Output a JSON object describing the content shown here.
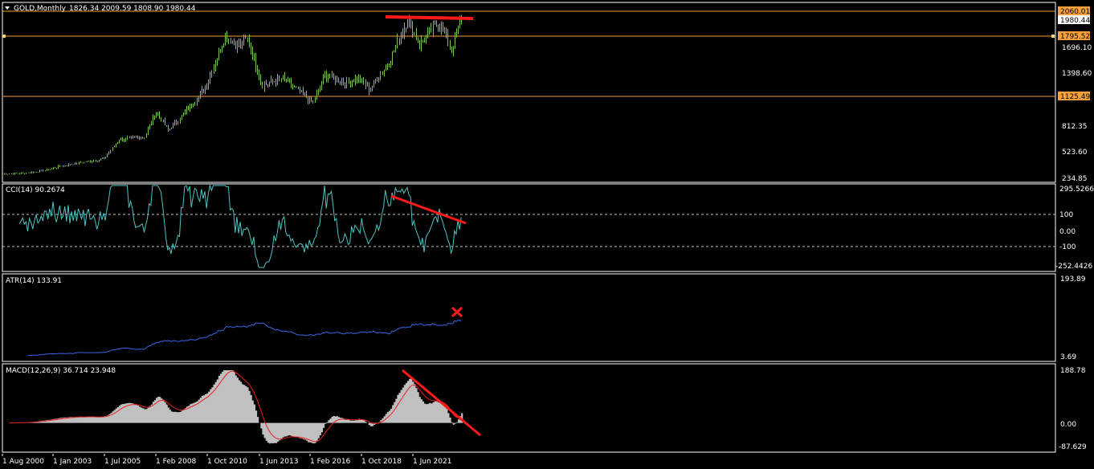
{
  "colors": {
    "background": "#000000",
    "frame": "#ffffff",
    "candles": "#7cc354",
    "level_line": "#f7a13a",
    "cci_line": "#4fc3c3",
    "atr_line": "#3d63e8",
    "macd_histogram": "#c0c0c0",
    "macd_signal": "#e81f1f",
    "drawing": "#ff1a1a",
    "dotted_level": "#c0c0c0"
  },
  "main_panel": {
    "header_symbol": "GOLD,Monthly",
    "header_values": "1826.34 2009.59 1808.90 1980.44",
    "price_axis": [
      "1696.10",
      "1398.60",
      "812.35",
      "523.60",
      "234.85"
    ],
    "price_tags": [
      {
        "text": "2060.01",
        "style": "orange"
      },
      {
        "text": "1980.44",
        "style": "white"
      },
      {
        "text": "1795.52",
        "style": "orange"
      },
      {
        "text": "1125.49",
        "style": "orange"
      }
    ]
  },
  "cci_panel": {
    "header": "CCI(14) 90.2674",
    "axis": [
      "295.5266",
      "100",
      "0.00",
      "-100",
      "-252.4426"
    ]
  },
  "atr_panel": {
    "header": "ATR(14) 133.91",
    "axis": [
      "193.89",
      "3.69"
    ],
    "marker_icon": "x-mark"
  },
  "macd_panel": {
    "header": "MACD(12,26,9) 36.714 23.948",
    "axis": [
      "188.78",
      "0.00",
      "-87.629"
    ]
  },
  "time_axis": [
    "1 Aug 2000",
    "1 Jan 2003",
    "1 Jul 2005",
    "1 Feb 2008",
    "1 Oct 2010",
    "1 Jun 2013",
    "1 Feb 2016",
    "1 Oct 2018",
    "1 Jun 2021"
  ],
  "chart_data": {
    "type": "candlestick",
    "symbol": "GOLD",
    "timeframe": "Monthly",
    "price_range": [
      234.85,
      2060.01
    ],
    "horizontal_levels": [
      2060.01,
      1795.52,
      1125.49
    ],
    "price_path": [
      [
        "2000-08",
        275
      ],
      [
        "2001-08",
        280
      ],
      [
        "2002-08",
        310
      ],
      [
        "2003-08",
        365
      ],
      [
        "2004-08",
        400
      ],
      [
        "2005-08",
        440
      ],
      [
        "2006-05",
        650
      ],
      [
        "2007-08",
        680
      ],
      [
        "2008-03",
        960
      ],
      [
        "2008-10",
        750
      ],
      [
        "2009-08",
        950
      ],
      [
        "2010-08",
        1220
      ],
      [
        "2011-08",
        1800
      ],
      [
        "2012-03",
        1680
      ],
      [
        "2012-09",
        1750
      ],
      [
        "2013-06",
        1250
      ],
      [
        "2014-06",
        1320
      ],
      [
        "2015-12",
        1060
      ],
      [
        "2016-07",
        1350
      ],
      [
        "2017-08",
        1280
      ],
      [
        "2018-03",
        1330
      ],
      [
        "2018-09",
        1200
      ],
      [
        "2019-09",
        1500
      ],
      [
        "2020-08",
        1970
      ],
      [
        "2021-03",
        1700
      ],
      [
        "2021-08",
        1800
      ],
      [
        "2022-03",
        1950
      ],
      [
        "2022-10",
        1630
      ],
      [
        "2023-04",
        1990
      ]
    ],
    "cci_levels": [
      100,
      0,
      -100
    ],
    "cci_range": [
      -252.4426,
      295.5266
    ],
    "atr_range": [
      3.69,
      193.89
    ],
    "macd_range": [
      -87.629,
      188.78
    ]
  }
}
